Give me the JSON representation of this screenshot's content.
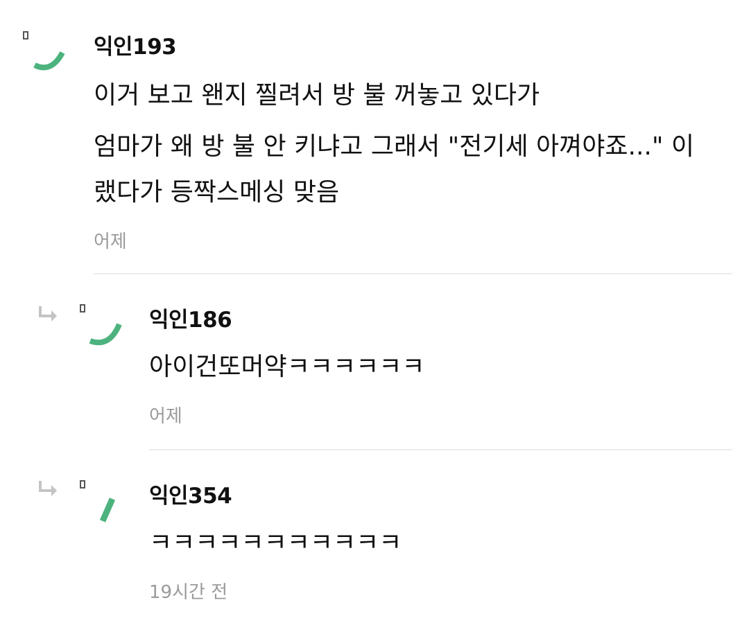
{
  "colors": {
    "avatar_green": "#4db37e",
    "text": "#111111",
    "muted": "#9a9a9a",
    "divider": "#ededed",
    "reply_arrow": "#c4c4c4"
  },
  "icons": {
    "reply": "reply-arrow-icon",
    "avatar": "avatar-placeholder-icon"
  },
  "comments": [
    {
      "author": "익인193",
      "lines": [
        "이거 보고 왠지 찔려서 방 불 꺼놓고 있다가",
        "엄마가 왜 방 불 안 키냐고 그래서 \"전기세 아껴야죠...\" 이",
        "랬다가 등짝스메싱 맞음"
      ],
      "time": "어제",
      "is_reply": false
    },
    {
      "author": "익인186",
      "lines": [
        "아이건또머약ㅋㅋㅋㅋㅋㅋ"
      ],
      "time": "어제",
      "is_reply": true
    },
    {
      "author": "익인354",
      "lines": [
        "ㅋㅋㅋㅋㅋㅋㅋㅋㅋㅋㅋ"
      ],
      "time": "19시간 전",
      "is_reply": true
    }
  ]
}
